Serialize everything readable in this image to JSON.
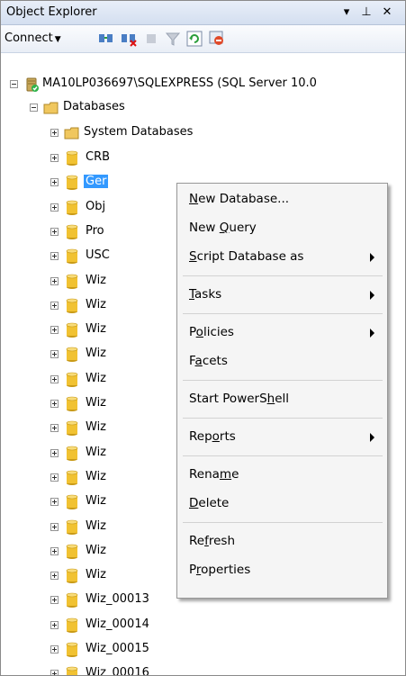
{
  "panel": {
    "title": "Object Explorer",
    "pin_glyph": "▾",
    "autohide_glyph": "⊥",
    "close_glyph": "✕"
  },
  "toolbar": {
    "connect_label": "Connect",
    "connect_caret": "▼"
  },
  "tree": {
    "server": "MA10LP036697\\SQLEXPRESS (SQL Server 10.0",
    "databases_folder": "Databases",
    "system_databases": "System Databases",
    "items": [
      "CRB",
      "Ger",
      "Obj",
      "Pro",
      "USC",
      "Wiz",
      "Wiz",
      "Wiz",
      "Wiz",
      "Wiz",
      "Wiz",
      "Wiz",
      "Wiz",
      "Wiz",
      "Wiz",
      "Wiz",
      "Wiz",
      "Wiz",
      "Wiz_00013",
      "Wiz_00014",
      "Wiz_00015",
      "Wiz_00016"
    ]
  },
  "context_menu": {
    "new_database": {
      "pre": "",
      "key": "N",
      "post": "ew Database..."
    },
    "new_query": {
      "pre": "New ",
      "key": "Q",
      "post": "uery"
    },
    "script_database_as": {
      "pre": "",
      "key": "S",
      "post": "cript Database as"
    },
    "tasks": {
      "pre": "",
      "key": "T",
      "post": "asks"
    },
    "policies": {
      "pre": "P",
      "key": "o",
      "post": "licies"
    },
    "facets": {
      "pre": "F",
      "key": "a",
      "post": "cets"
    },
    "start_powershell": {
      "pre": "Start PowerS",
      "key": "h",
      "post": "ell"
    },
    "reports": {
      "pre": "Rep",
      "key": "o",
      "post": "rts"
    },
    "rename": {
      "pre": "Rena",
      "key": "m",
      "post": "e"
    },
    "delete": {
      "pre": "",
      "key": "D",
      "post": "elete"
    },
    "refresh": {
      "pre": "Re",
      "key": "f",
      "post": "resh"
    },
    "properties": {
      "pre": "P",
      "key": "r",
      "post": "operties"
    }
  },
  "colors": {
    "selection": "#3399ff",
    "cylinder": "#f1c232",
    "folder": "#f0c75e"
  }
}
